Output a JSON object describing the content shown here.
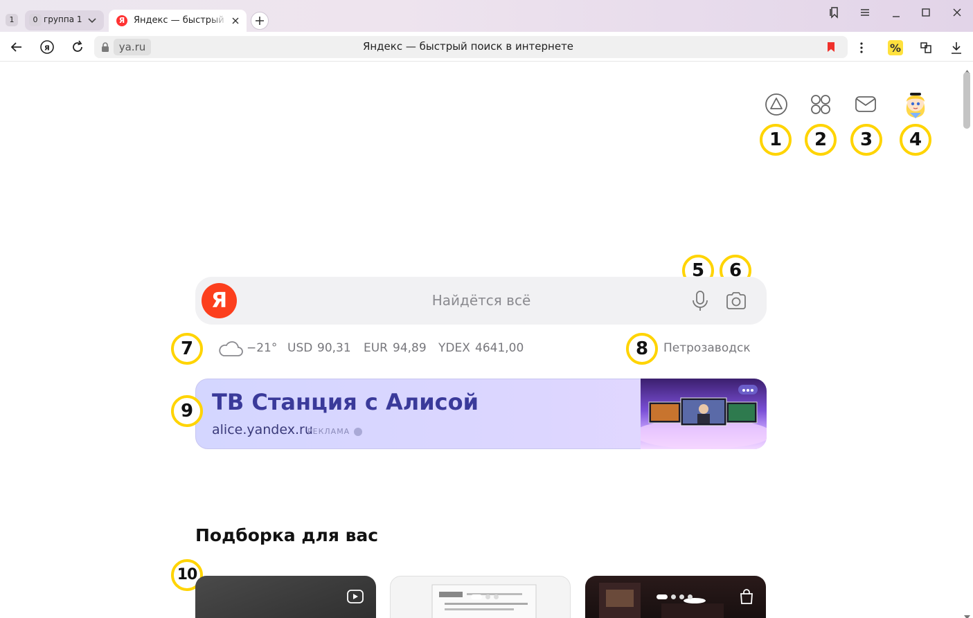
{
  "browser": {
    "tabs": {
      "first_count": "1",
      "group_count": "0",
      "group_label": "группа 1",
      "active_tab_title": "Яндекс — быстрый поиск в интернете",
      "favicon_letter": "Я"
    },
    "omnibox": {
      "domain": "ya.ru",
      "title": "Яндекс — быстрый поиск в интернете"
    },
    "icons": [
      "back-icon",
      "yandex-home-icon",
      "reload-icon",
      "lock-icon",
      "bookmark-icon",
      "more-icon",
      "discount-extension-icon",
      "collections-icon",
      "download-icon",
      "bookmarks-panel-icon",
      "menu-icon",
      "minimize-icon",
      "maximize-icon",
      "close-icon"
    ]
  },
  "header": {
    "icons": [
      "alice-icon",
      "services-icon",
      "mail-icon",
      "avatar"
    ],
    "badges": [
      "1",
      "2",
      "3",
      "4"
    ]
  },
  "search": {
    "logo": "Я",
    "placeholder": "Найдётся всё",
    "badges": [
      "5",
      "6"
    ]
  },
  "informers": {
    "badge": "7",
    "temperature": "−21°",
    "usd_label": "USD",
    "usd_value": "90,31",
    "eur_label": "EUR",
    "eur_value": "94,89",
    "ydex_label": "YDEX",
    "ydex_value": "4641,00",
    "city_badge": "8",
    "city": "Петрозаводск"
  },
  "ad": {
    "badge": "9",
    "title": "ТВ Станция с Алисой",
    "domain": "alice.yandex.ru",
    "label": "РЕКЛАМА"
  },
  "feed": {
    "title": "Подборка для вас",
    "badge": "10",
    "card_icons": [
      "video-icon",
      "shopping-bag-icon"
    ]
  },
  "colors": {
    "accent": "#fc3f1d",
    "badge_ring": "#ffd400",
    "ad_title": "#3a3a9a"
  }
}
